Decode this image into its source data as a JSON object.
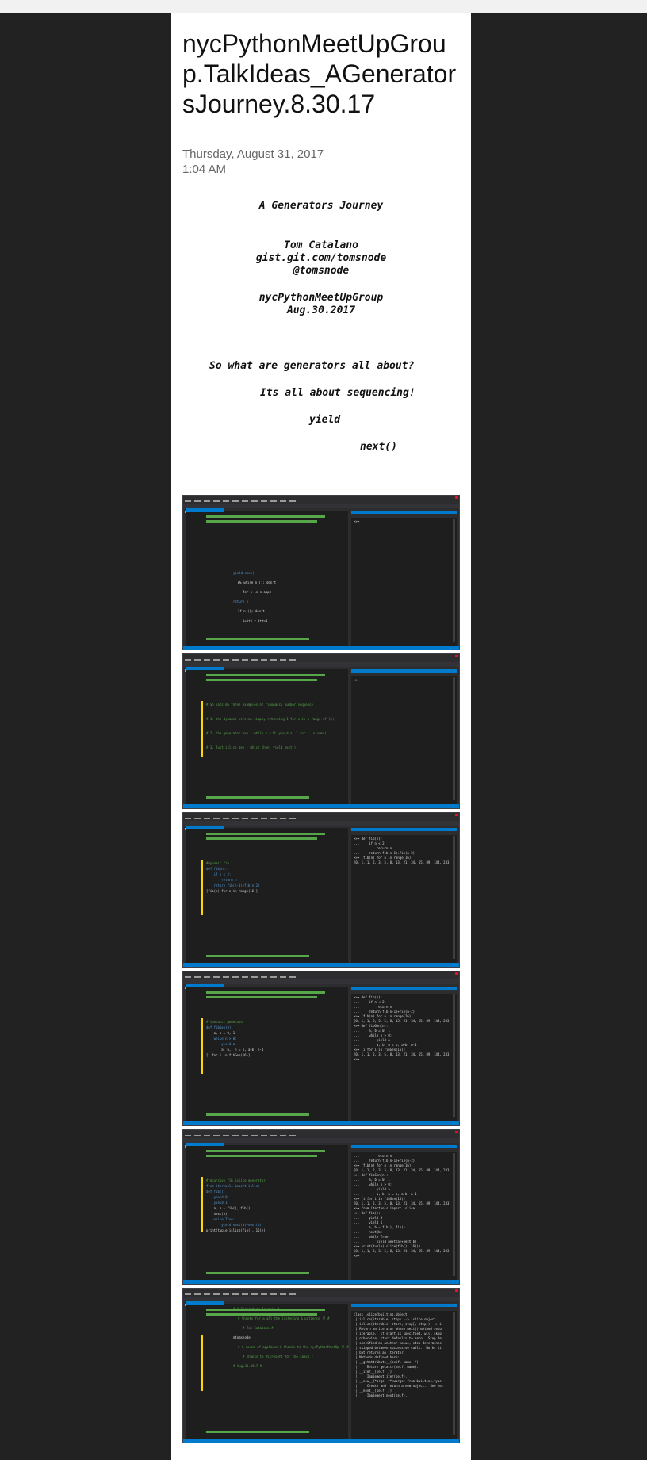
{
  "page": {
    "title": "nycPythonMeetUpGroup.TalkIdeas_AGeneratorsJourney.8.30.17",
    "date": "Thursday, August 31, 2017",
    "time": "1:04 AM"
  },
  "notes": {
    "heading": "A Generators Journey",
    "author": "Tom Catalano",
    "gist": "gist.git.com/tomsnode",
    "handle": "@tomsnode",
    "group": "nycPythonMeetUpGroup",
    "event_date": "Aug.30.2017",
    "question": "So what are generators all about?",
    "answer": "Its all about sequencing!",
    "kw_yield": "yield",
    "kw_next": "next()"
  },
  "screenshots": [
    {
      "editor": [
        "yield next()",
        "WE while n (); don't",
        "for n in n-appc",
        "return n",
        "If n (); don't",
        "i=i+1 + i++=1"
      ],
      "repl": [
        ">>> |"
      ]
    },
    {
      "editor": [
        "# So lets do three examples of fibonacci number sequence",
        "# 1. the dynamic version simply returning 1 for n in a range of (n)",
        "# 2. the generator way - while n < N: yield a, 1 for i in sum()",
        "# 3. Just islice gen - which then: yield next()"
      ],
      "repl": [
        ">>> |"
      ]
    },
    {
      "editor": [
        "#dynamic fib",
        "def fib(n):",
        "    if n < 2:",
        "        return n",
        "    return fib(n-1)+fib(n-2)",
        "[fib(n) for n in range(16)]"
      ],
      "repl": [
        ">>> def fib(n):",
        "...     if n < 2:",
        "...         return n",
        "...     return fib(n-1)+fib(n-2)",
        ">>> [fib(n) for n in range(16)]",
        "[0, 1, 1, 2, 3, 5, 8, 13, 21, 34, 55, 89, 144, 233]"
      ]
    },
    {
      "editor": [
        "#fibonacci generator",
        "def fibGen(n):",
        "    a, b = 0, 1",
        "    while n > 0:",
        "        yield a",
        "        a, b,  n = b, a+b, n-1",
        "[i for i in fibGen(16)]"
      ],
      "repl": [
        ">>> def fib(n):",
        "...     if n < 2:",
        "...         return n",
        "...     return fib(n-1)+fib(n-2)",
        ">>> [fib(n) for n in range(16)]",
        "[0, 1, 1, 2, 3, 5, 8, 13, 21, 34, 55, 89, 144, 233]",
        ">>> def fibGen(n):",
        "...     a, b = 0, 1",
        "...     while n > 0:",
        "...         yield a",
        "...         a, b, n = b, a+b, n-1",
        ">>> [i for i in fibGen(16)]",
        "[0, 1, 1, 2, 3, 5, 8, 13, 21, 34, 55, 89, 144, 233]",
        ">>>"
      ]
    },
    {
      "editor": [
        "#recursive fib islice generator",
        "from itertools import islice",
        "def fib():",
        "    yield 0",
        "    yield 1",
        "    a, b = fib(), fib()",
        "    next(b)",
        "    while True:",
        "        yield next(a)+next(b)",
        "print(tuple(islice(fib(), 16)))"
      ],
      "repl": [
        "...         return n",
        "...     return fib(n-1)+fib(n-2)",
        ">>> [fib(n) for n in range(16)]",
        "[0, 1, 1, 2, 3, 5, 8, 13, 21, 34, 55, 89, 144, 233]",
        ">>> def fibGen(n):",
        "...     a, b = 0, 1",
        "...     while n > 0:",
        "...         yield a",
        "...         a, b, n = b, a+b, n-1",
        ">>> [i for i in fibGen(16)]",
        "[0, 1, 1, 2, 3, 5, 8, 13, 21, 34, 55, 89, 144, 233]",
        ">>> from itertools import islice",
        ">>> def fib():",
        "...     yield 0",
        "...     yield 1",
        "...     a, b = fib(), fib()",
        "...     next(b)",
        "...     while True:",
        "...         yield next(a)+next(b)",
        ">>> print(tuple(islice(fib(), 16)))",
        "(0, 1, 1, 2, 3, 5, 8, 13, 21, 34, 55, 89, 144, 233)",
        ">>>"
      ]
    },
    {
      "editor": [
        "# A Generators Journey #",
        "# thanks for a all the listening & patience !! #",
        "# Tom Catalano #",
        "@tomsnode",
        "# A round of applause & thanks to the nycPythonMeetUp !! #",
        "# Thanks to Microsoft for the space !",
        "# Aug.30.2017 #"
      ],
      "repl": [
        "class islice(builtins.object)",
        " | islice(iterable, stop) --> islice object",
        " | islice(iterable, start, stop[, step]) --> i",
        " | Return an iterator whose next() method retu",
        " | iterable.  If start is specified, will skip",
        " | otherwise, start defaults to zero.  Step de",
        " | specified as another value, step determines",
        " | skipped between successive calls.  Works li",
        " | but returns an iterator.",
        " | Methods defined here:",
        " | __getattribute__(self, name, /)",
        " |     Return getattr(self, name).",
        " | __iter__(self, /)",
        " |     Implement iter(self).",
        " | __new__(*args, **kwargs) from builtins.type",
        " |     Create and return a new object.  See hel",
        " | __next__(self, /)",
        " |     Implement next(self)."
      ]
    }
  ]
}
